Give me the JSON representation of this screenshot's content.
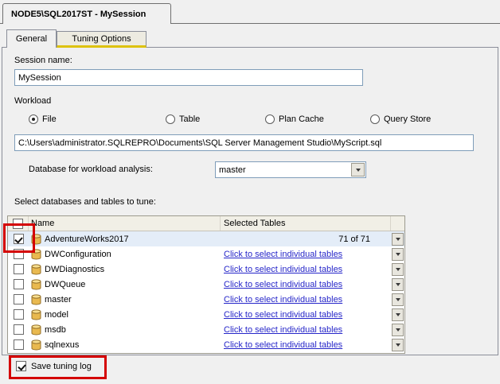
{
  "window": {
    "title_tab": "NODE5\\SQL2017ST - MySession"
  },
  "tabs": {
    "general": "General",
    "tuning_options": "Tuning Options"
  },
  "session": {
    "label": "Session name:",
    "value": "MySession"
  },
  "workload": {
    "label": "Workload",
    "options": [
      {
        "label": "File",
        "selected": true
      },
      {
        "label": "Table",
        "selected": false
      },
      {
        "label": "Plan Cache",
        "selected": false
      },
      {
        "label": "Query Store",
        "selected": false
      }
    ],
    "file_path": "C:\\Users\\administrator.SQLREPRO\\Documents\\SQL Server Management Studio\\MyScript.sql",
    "analysis_db_label": "Database for workload analysis:",
    "analysis_db_value": "master"
  },
  "tune": {
    "label": "Select databases and tables to tune:",
    "table": {
      "header": {
        "name": "Name",
        "selected_tables": "Selected Tables",
        "checked": false
      },
      "rows": [
        {
          "name": "AdventureWorks2017",
          "checked": true,
          "selected": "71 of 71"
        },
        {
          "name": "DWConfiguration",
          "checked": false,
          "selected": "Click to select individual tables"
        },
        {
          "name": "DWDiagnostics",
          "checked": false,
          "selected": "Click to select individual tables"
        },
        {
          "name": "DWQueue",
          "checked": false,
          "selected": "Click to select individual tables"
        },
        {
          "name": "master",
          "checked": false,
          "selected": "Click to select individual tables"
        },
        {
          "name": "model",
          "checked": false,
          "selected": "Click to select individual tables"
        },
        {
          "name": "msdb",
          "checked": false,
          "selected": "Click to select individual tables"
        },
        {
          "name": "sqlnexus",
          "checked": false,
          "selected": "Click to select individual tables"
        }
      ]
    }
  },
  "footer": {
    "save_tuning_log": "Save tuning log",
    "checked": true
  },
  "colors": {
    "annotation": "#D40000",
    "link": "#2626C9",
    "tab_accent": "#DDC20A"
  }
}
